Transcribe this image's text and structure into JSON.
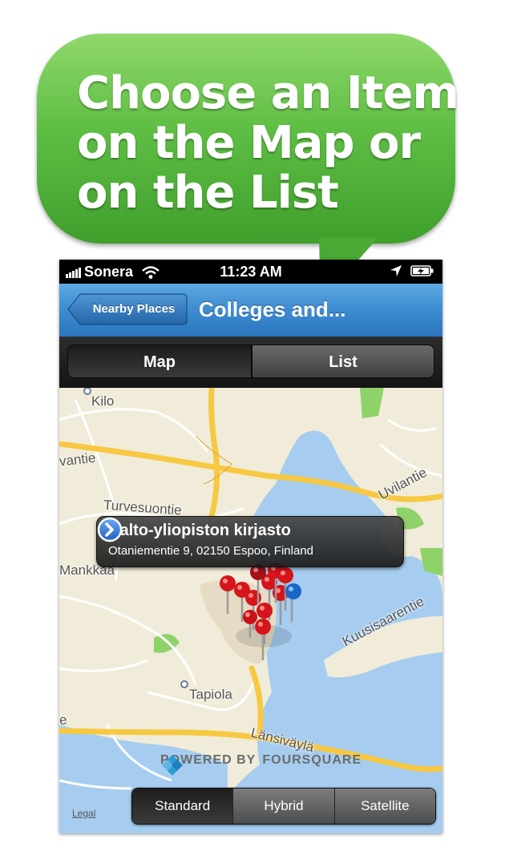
{
  "bubble": {
    "lines": [
      "Choose an Item",
      "on the Map or",
      "on the List"
    ]
  },
  "status": {
    "carrier": "Sonera",
    "time": "11:23 AM"
  },
  "nav": {
    "back_label": "Nearby Places",
    "title": "Colleges and..."
  },
  "segments": {
    "map": "Map",
    "list": "List",
    "selected": "Map"
  },
  "map": {
    "labels": {
      "kilo": "Kilo",
      "vantie": "vantie",
      "turvesuontie": "Turvesuontie",
      "mankkaa": "Mankkaa",
      "tapiola": "Tapiola",
      "e_partial": "e",
      "uvilantie": "Uvilantie",
      "kuusisaarentie": "Kuusisaarentie",
      "lansivayla": "Länsiväylä"
    },
    "callout": {
      "title": "Aalto-yliopiston kirjasto",
      "subtitle": "Otaniementie 9, 02150 Espoo, Finland"
    },
    "powered_by": "POWERED BY",
    "provider": "FOURSQUARE",
    "legal": "Legal",
    "map_types": [
      "Standard",
      "Hybrid",
      "Satellite"
    ],
    "selected_map_type": "Standard"
  },
  "colors": {
    "bubble_green": "#5fbe44",
    "nav_blue": "#3d8bd0",
    "water": "#a6cdef",
    "land": "#f1ecd9",
    "road_yellow": "#f7c842",
    "park_green": "#8fd26a",
    "pin_red": "#d5151b",
    "pin_blue": "#1a66c8"
  }
}
